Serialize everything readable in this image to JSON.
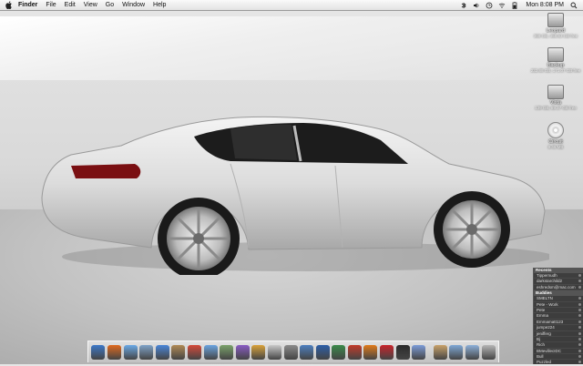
{
  "menubar": {
    "items": [
      "Finder",
      "File",
      "Edit",
      "View",
      "Go",
      "Window",
      "Help"
    ],
    "clock": "Mon 8:08 PM"
  },
  "desktop_icons": [
    {
      "label": "Leopard",
      "sub": "369 GB, 358.83 GB free"
    },
    {
      "label": "Backup",
      "sub": "232.88 GB, 171.07 GB free"
    },
    {
      "label": "Vista",
      "sub": "139 GB, 89.37 GB free"
    },
    {
      "label": "Circuit",
      "sub": "9.45 MB"
    }
  ],
  "widget": {
    "recent_header": "Recents",
    "recent": [
      "Tippernudh",
      "darkstarchild2",
      "eshredsm@mac.com"
    ],
    "buddies_header": "Buddies",
    "buddies": [
      "SMELTN",
      "Pete - Work",
      "Pete",
      "Emma",
      "Emmamatt123",
      "jumpe224",
      "jenifferg",
      "Bj",
      "Rich",
      "BMevillecIDC",
      "Bull",
      "Puzzled"
    ]
  },
  "dock_icons": [
    "finder-icon",
    "firefox-icon",
    "safari-icon",
    "mail-icon",
    "ichat-icon",
    "address-book-icon",
    "ical-icon",
    "itunes-icon",
    "iphoto-icon",
    "imovie-icon",
    "garageband-icon",
    "preview-icon",
    "system-preferences-icon",
    "timemachine-icon",
    "photoshop-icon",
    "dreamweaver-icon",
    "flash-icon",
    "illustrator-icon",
    "acrobat-icon",
    "terminal-icon",
    "adium-icon",
    "stack-documents-icon",
    "stack-applications-icon",
    "stack-downloads-icon",
    "trash-icon"
  ],
  "colors": {
    "dock_colors": [
      "#3c78c8",
      "#e06a1f",
      "#6aa9e6",
      "#7fa3c8",
      "#4a86d8",
      "#b08a55",
      "#d54a3a",
      "#6aa4e0",
      "#7aa26a",
      "#8a5cc4",
      "#d9a23a",
      "#c9c9c9",
      "#8c8c8c",
      "#4d7fbf",
      "#2d5fa8",
      "#3b8a4a",
      "#c23b2a",
      "#e07a1a",
      "#c8242b",
      "#2b2b2b",
      "#7c9cd8",
      "#c9a26a",
      "#7fa8d6",
      "#8db0d9",
      "#b5b5b5"
    ]
  }
}
